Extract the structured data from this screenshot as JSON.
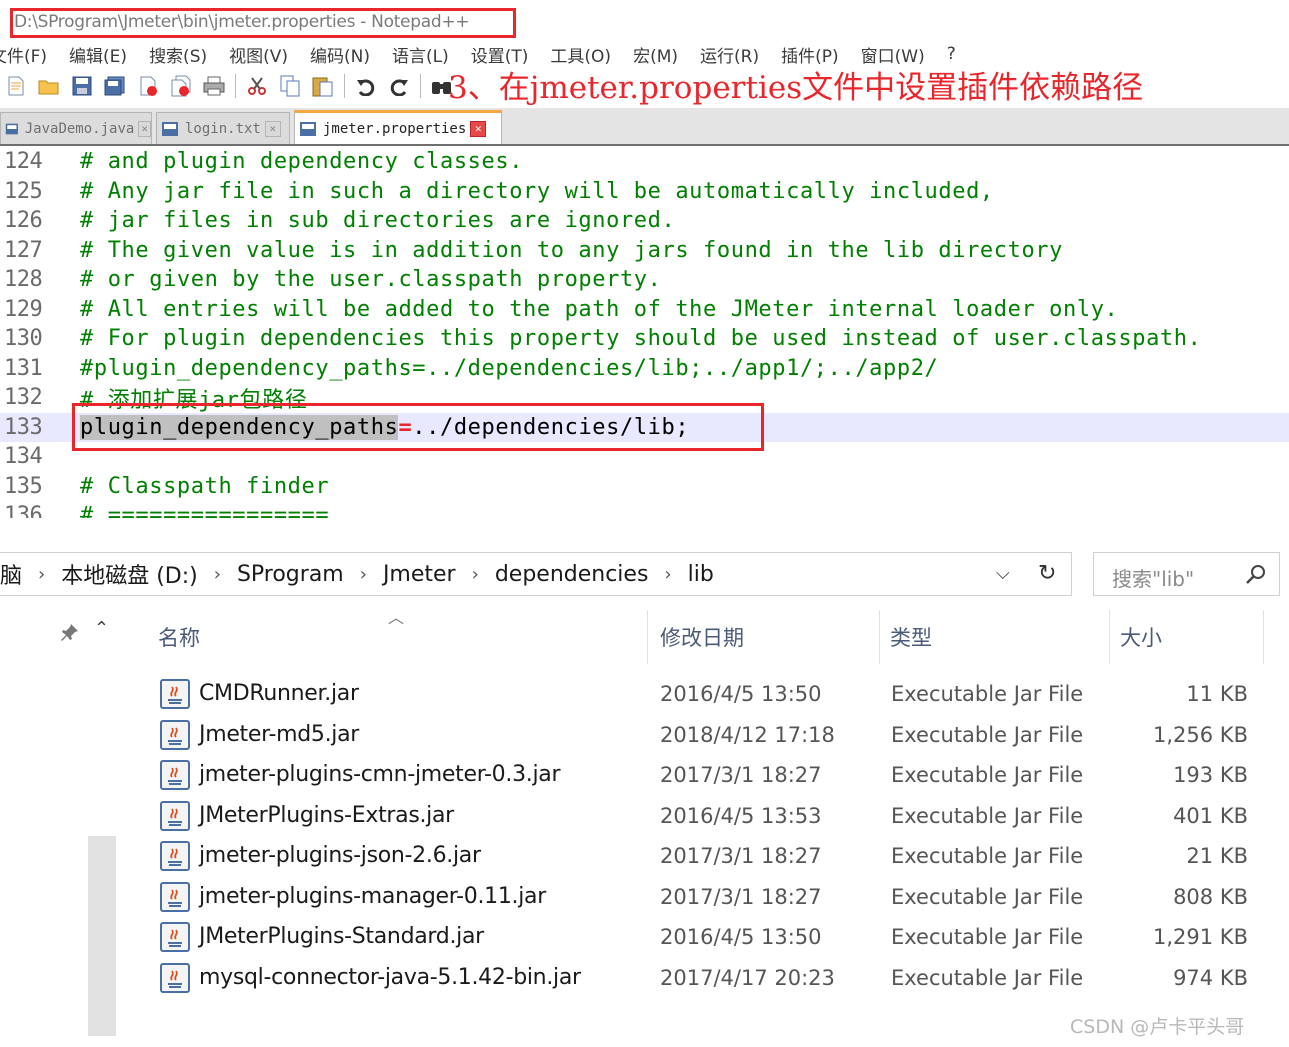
{
  "notepad": {
    "title": "D:\\SProgram\\Jmeter\\bin\\jmeter.properties - Notepad++",
    "menu": [
      "文件(F)",
      "编辑(E)",
      "搜索(S)",
      "视图(V)",
      "编码(N)",
      "语言(L)",
      "设置(T)",
      "工具(O)",
      "宏(M)",
      "运行(R)",
      "插件(P)",
      "窗口(W)",
      "?"
    ],
    "annotation": "3、在jmeter.properties文件中设置插件依赖路径",
    "tabs": [
      {
        "label": "JavaDemo.java",
        "active": false
      },
      {
        "label": "login.txt",
        "active": false
      },
      {
        "label": "jmeter.properties",
        "active": true
      }
    ],
    "lines": [
      {
        "num": "124",
        "text": "# and plugin dependency classes."
      },
      {
        "num": "125",
        "text": "# Any jar file in such a directory will be automatically included,"
      },
      {
        "num": "126",
        "text": "# jar files in sub directories are ignored."
      },
      {
        "num": "127",
        "text": "# The given value is in addition to any jars found in the lib directory"
      },
      {
        "num": "128",
        "text": "# or given by the user.classpath property."
      },
      {
        "num": "129",
        "text": "# All entries will be added to the path of the JMeter internal loader only."
      },
      {
        "num": "130",
        "text": "# For plugin dependencies this property should be used instead of user.classpath."
      },
      {
        "num": "131",
        "text": "#plugin_dependency_paths=../dependencies/lib;../app1/;../app2/"
      },
      {
        "num": "132",
        "text": "# 添加扩展jar包路径"
      },
      {
        "num": "133",
        "key": "plugin_dependency_paths",
        "eq": "=",
        "value": "../dependencies/lib;"
      },
      {
        "num": "134",
        "text": ""
      },
      {
        "num": "135",
        "text": "# Classpath finder"
      },
      {
        "num": "136",
        "text": "# ================"
      }
    ]
  },
  "explorer": {
    "breadcrumb": [
      "脑",
      "本地磁盘 (D:)",
      "SProgram",
      "Jmeter",
      "dependencies",
      "lib"
    ],
    "search_placeholder": "搜索\"lib\"",
    "columns": {
      "name": "名称",
      "date": "修改日期",
      "type": "类型",
      "size": "大小"
    },
    "files": [
      {
        "name": "CMDRunner.jar",
        "date": "2016/4/5 13:50",
        "type": "Executable Jar File",
        "size": "11 KB"
      },
      {
        "name": "Jmeter-md5.jar",
        "date": "2018/4/12 17:18",
        "type": "Executable Jar File",
        "size": "1,256 KB"
      },
      {
        "name": "jmeter-plugins-cmn-jmeter-0.3.jar",
        "date": "2017/3/1 18:27",
        "type": "Executable Jar File",
        "size": "193 KB"
      },
      {
        "name": "JMeterPlugins-Extras.jar",
        "date": "2016/4/5 13:53",
        "type": "Executable Jar File",
        "size": "401 KB"
      },
      {
        "name": "jmeter-plugins-json-2.6.jar",
        "date": "2017/3/1 18:27",
        "type": "Executable Jar File",
        "size": "21 KB"
      },
      {
        "name": "jmeter-plugins-manager-0.11.jar",
        "date": "2017/3/1 18:27",
        "type": "Executable Jar File",
        "size": "808 KB"
      },
      {
        "name": "JMeterPlugins-Standard.jar",
        "date": "2016/4/5 13:50",
        "type": "Executable Jar File",
        "size": "1,291 KB"
      },
      {
        "name": "mysql-connector-java-5.1.42-bin.jar",
        "date": "2017/4/17 20:23",
        "type": "Executable Jar File",
        "size": "974 KB"
      }
    ]
  },
  "watermark": "CSDN @卢卡平头哥",
  "colors": {
    "highlight_red": "#e8262b",
    "comment_green": "#008000",
    "current_line": "#e8e8ff"
  }
}
